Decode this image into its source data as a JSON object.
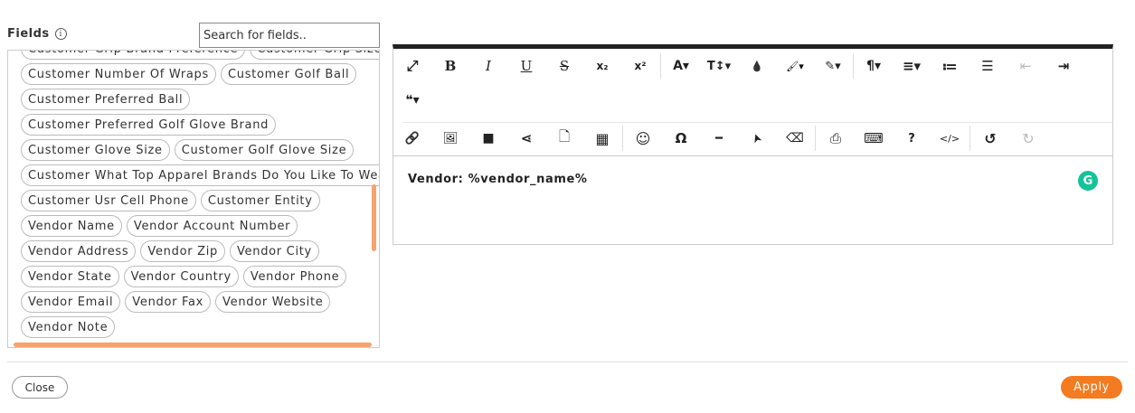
{
  "fields_label": "Fields",
  "search": {
    "placeholder": "Search for fields.."
  },
  "tag_rows": [
    [
      "Customer Grip Brand Preference",
      "Customer Grip Size"
    ],
    [
      "Customer Number Of Wraps",
      "Customer Golf Ball"
    ],
    [
      "Customer Preferred Ball"
    ],
    [
      "Customer Preferred Golf Glove Brand"
    ],
    [
      "Customer Glove Size",
      "Customer Golf Glove Size"
    ],
    [
      "Customer What Top Apparel Brands Do You Like To Wear?"
    ],
    [
      "Customer Usr Cell Phone",
      "Customer Entity"
    ],
    [
      "Vendor Name",
      "Vendor Account Number"
    ],
    [
      "Vendor Address",
      "Vendor Zip",
      "Vendor City"
    ],
    [
      "Vendor State",
      "Vendor Country",
      "Vendor Phone"
    ],
    [
      "Vendor Email",
      "Vendor Fax",
      "Vendor Website"
    ],
    [
      "Vendor Note"
    ]
  ],
  "editor": {
    "content": "Vendor: %vendor_name%",
    "grammarly_letter": "G"
  },
  "toolbar_row1": [
    {
      "name": "fullscreen-icon",
      "glyph": "⤢"
    },
    {
      "name": "bold-icon",
      "glyph": "B"
    },
    {
      "name": "italic-icon",
      "glyph": "I"
    },
    {
      "name": "underline-icon",
      "glyph": "U"
    },
    {
      "name": "strikethrough-icon",
      "glyph": "S"
    },
    {
      "name": "subscript-icon",
      "glyph": "x₂"
    },
    {
      "name": "superscript-icon",
      "glyph": "x²"
    },
    {
      "sep": true
    },
    {
      "name": "font-family-icon",
      "glyph": "A▾"
    },
    {
      "name": "font-size-icon",
      "glyph": "T↕▾"
    },
    {
      "name": "text-color-icon",
      "glyph": "💧"
    },
    {
      "name": "paint-brush-icon",
      "glyph": "🖌▾"
    },
    {
      "name": "magic-wand-icon",
      "glyph": "✎▾"
    },
    {
      "sep": true
    },
    {
      "name": "paragraph-icon",
      "glyph": "¶▾"
    },
    {
      "name": "align-icon",
      "glyph": "≡▾"
    },
    {
      "name": "ordered-list-icon",
      "glyph": "≔"
    },
    {
      "name": "unordered-list-icon",
      "glyph": "☰"
    },
    {
      "name": "outdent-icon",
      "glyph": "⇤"
    },
    {
      "name": "indent-icon",
      "glyph": "⇥"
    }
  ],
  "toolbar_row2": [
    {
      "name": "quote-icon",
      "glyph": "❝▾"
    }
  ],
  "toolbar_row3": [
    {
      "name": "link-icon",
      "glyph": "🔗"
    },
    {
      "name": "image-icon",
      "glyph": "🖼"
    },
    {
      "name": "video-icon",
      "glyph": "■"
    },
    {
      "name": "share-icon",
      "glyph": "⋖"
    },
    {
      "name": "file-icon",
      "glyph": "🗋"
    },
    {
      "name": "table-icon",
      "glyph": "▦"
    },
    {
      "sep": true
    },
    {
      "name": "emoji-icon",
      "glyph": "☺"
    },
    {
      "name": "special-char-icon",
      "glyph": "Ω"
    },
    {
      "name": "horizontal-line-icon",
      "glyph": "━"
    },
    {
      "name": "select-all-icon",
      "glyph": "➤"
    },
    {
      "name": "clear-format-icon",
      "glyph": "⌫"
    },
    {
      "sep": true
    },
    {
      "name": "print-icon",
      "glyph": "⎙"
    },
    {
      "name": "keyboard-icon",
      "glyph": "⌨"
    },
    {
      "name": "help-icon",
      "glyph": "?"
    },
    {
      "name": "code-view-icon",
      "glyph": "</>"
    },
    {
      "sep": true
    },
    {
      "name": "undo-icon",
      "glyph": "↺"
    },
    {
      "name": "redo-icon",
      "glyph": "↻"
    }
  ],
  "buttons": {
    "close": "Close",
    "apply": "Apply"
  },
  "colors": {
    "accent": "#f47b20",
    "scrollbar": "#f7a26f",
    "grammarly": "#15c39a"
  }
}
